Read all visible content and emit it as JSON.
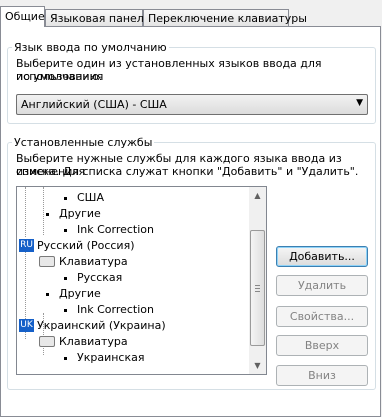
{
  "tabs": [
    "Общие",
    "Языковая панель",
    "Переключение клавиатуры"
  ],
  "default_input": {
    "legend": "Язык ввода по умолчанию",
    "description_line1": "Выберите один из установленных языков ввода для использования",
    "description_line2": "по умолчанию.",
    "selected": "Английский (США) - США"
  },
  "services": {
    "legend": "Установленные службы",
    "description_line1": "Выберите нужные службы для каждого языка ввода из списка. Для",
    "description_line2": "изменения списка служат кнопки \"Добавить\" и \"Удалить\".",
    "tree": [
      {
        "label": "США"
      },
      {
        "label": "Другие"
      },
      {
        "label": "Ink Correction"
      },
      {
        "label": "Русский (Россия)",
        "badge": "RU"
      },
      {
        "label": "Клавиатура"
      },
      {
        "label": "Русская"
      },
      {
        "label": "Другие"
      },
      {
        "label": "Ink Correction"
      },
      {
        "label": "Украинский (Украина)",
        "badge": "UK"
      },
      {
        "label": "Клавиатура"
      },
      {
        "label": "Украинская"
      }
    ],
    "buttons": {
      "add": "Добавить...",
      "remove": "Удалить",
      "properties": "Свойства...",
      "up": "Вверх",
      "down": "Вниз"
    }
  },
  "colors": {
    "flag_badge": "#1560c8",
    "focus_border": "#3c7fb1"
  }
}
